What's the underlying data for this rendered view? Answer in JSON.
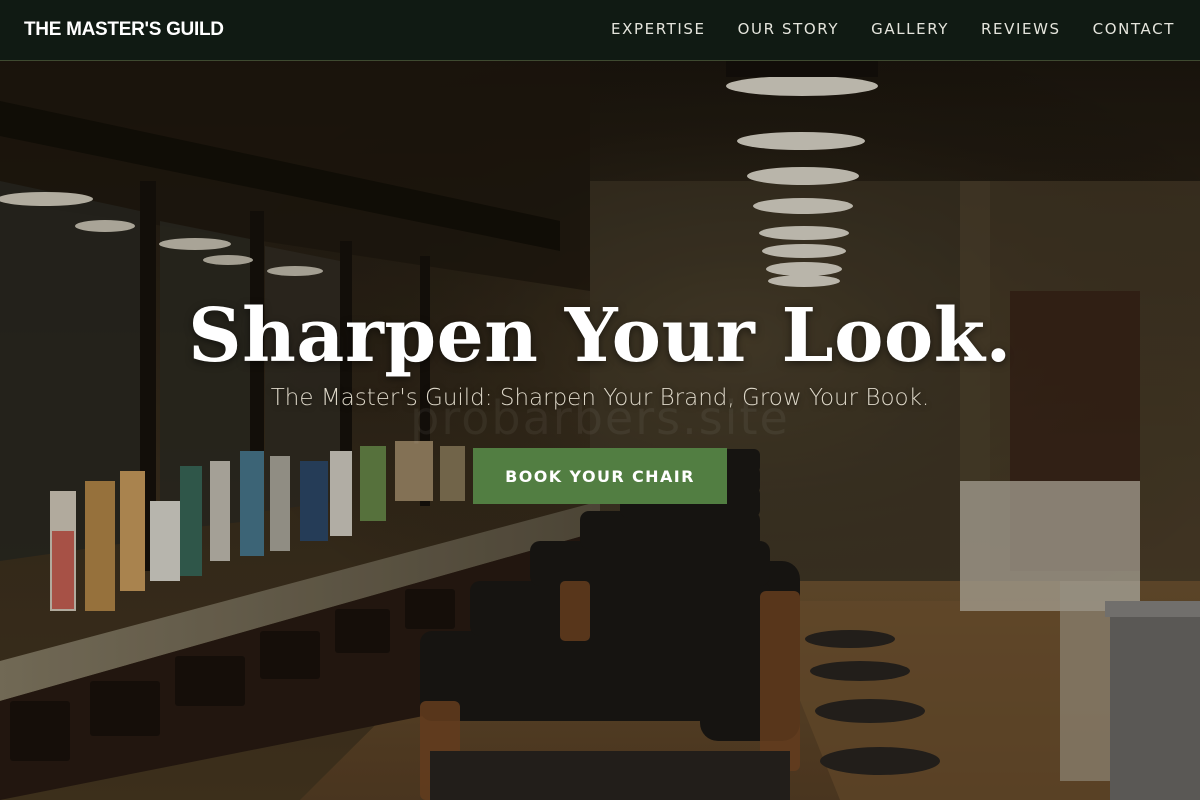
{
  "brand": {
    "name": "THE MASTER'S GUILD"
  },
  "nav": {
    "items": [
      {
        "label": "EXPERTISE"
      },
      {
        "label": "OUR STORY"
      },
      {
        "label": "GALLERY"
      },
      {
        "label": "REVIEWS"
      },
      {
        "label": "CONTACT"
      }
    ]
  },
  "hero": {
    "title": "Sharpen Your Look.",
    "subtitle": "The Master's Guild: Sharpen Your Brand, Grow Your Book.",
    "cta_label": "BOOK YOUR CHAIR",
    "watermark": "probarbers.site"
  },
  "colors": {
    "nav_background": "#101a13",
    "cta_background": "#527e42",
    "text_primary": "#ffffff"
  }
}
